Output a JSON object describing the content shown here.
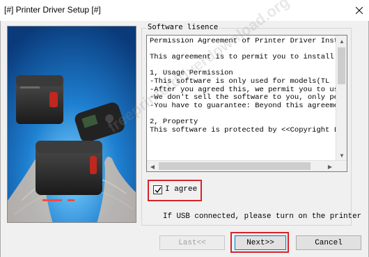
{
  "window": {
    "title": "[#] Printer Driver Setup [#]",
    "close_glyph": "✕"
  },
  "group": {
    "legend": "Software lisence"
  },
  "license": {
    "lines": [
      "Permission Agreement of Printer Driver Install",
      "",
      "This agreement is to permit you to install the",
      "",
      "1, Usage Permission",
      "-This software is only used for models(TL",
      "-After you agreed this, we permit you to use t",
      "-We don't sell the software to you, only permi",
      "-You have to guarantee: Beyond this agreement",
      "",
      "2, Property",
      "This software is protected by <<Copyright Law"
    ],
    "vscroll_icon": "up-down-arrows",
    "hscroll_icon": "left-right-arrows"
  },
  "agree": {
    "label": "I agree",
    "checked": true
  },
  "usb_note": "If USB connected, please turn on the printer",
  "buttons": {
    "back": "Last<<",
    "next": "Next>>",
    "cancel": "Cancel"
  },
  "watermark": "freeprinterdriverdownload.org",
  "colors": {
    "highlight": "#d8232a",
    "focus": "#0078d7"
  }
}
